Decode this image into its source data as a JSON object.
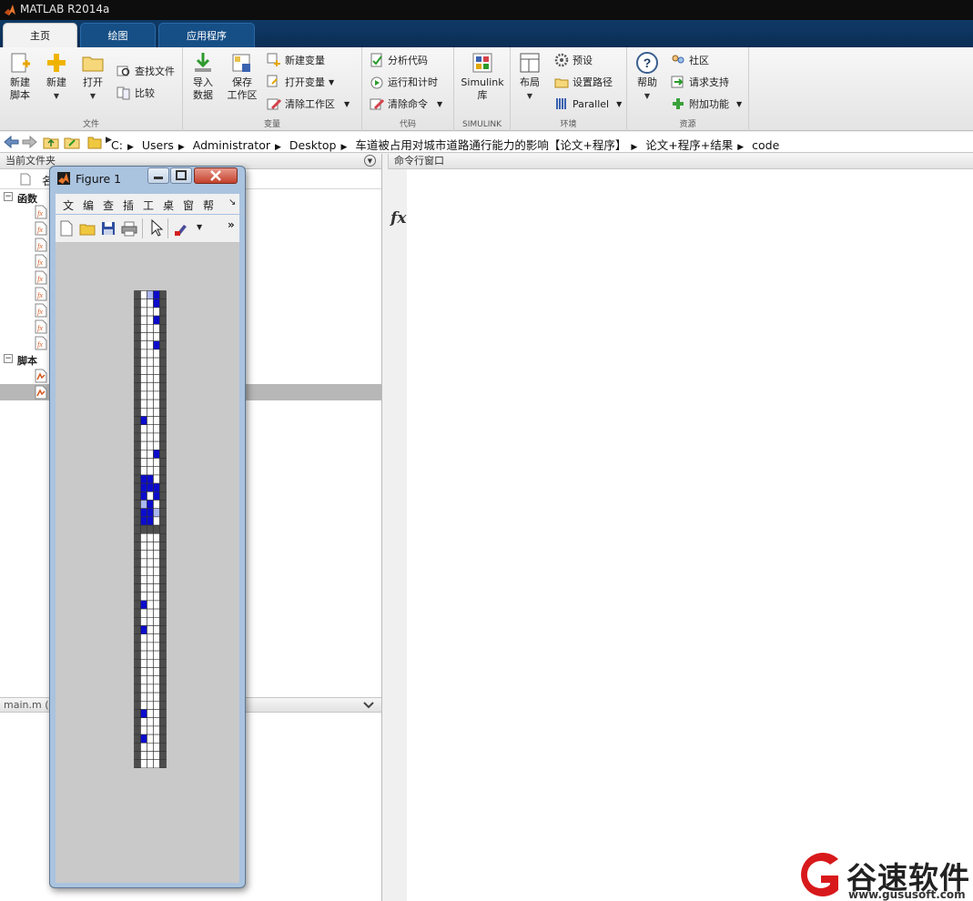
{
  "window": {
    "title": "MATLAB R2014a"
  },
  "tabs": [
    {
      "label": "主页"
    },
    {
      "label": "绘图"
    },
    {
      "label": "应用程序"
    }
  ],
  "ribbon": {
    "file": {
      "label": "文件",
      "new_script": [
        "新建",
        "脚本"
      ],
      "new": "新建",
      "open": "打开",
      "find_files": "查找文件",
      "compare": "比较"
    },
    "variable": {
      "label": "变量",
      "import": [
        "导入",
        "数据"
      ],
      "save": [
        "保存",
        "工作区"
      ],
      "new_var": "新建变量",
      "open_var": "打开变量",
      "clear_ws": "清除工作区"
    },
    "code": {
      "label": "代码",
      "analyze": "分析代码",
      "run_time": "运行和计时",
      "clear_cmd": "清除命令"
    },
    "simulink": {
      "label": "SIMULINK",
      "lib": [
        "Simulink",
        "库"
      ]
    },
    "env": {
      "label": "环境",
      "layout": "布局",
      "prefs": "预设",
      "set_path": "设置路径",
      "parallel": "Parallel"
    },
    "resources": {
      "label": "资源",
      "help": "帮助",
      "community": "社区",
      "support": "请求支持",
      "addons": "附加功能"
    }
  },
  "address": {
    "segments": [
      "C:",
      "Users",
      "Administrator",
      "Desktop",
      "车道被占用对城市道路通行能力的影响【论文+程序】",
      "论文+程序+结果",
      "code"
    ]
  },
  "left_panel": {
    "title": "当前文件夹",
    "column_name": "名",
    "section_functions": "函数",
    "section_scripts": "脚本",
    "details_file": "main.m ("
  },
  "cmd_window": {
    "title": "命令行窗口",
    "prompt": "fx"
  },
  "figure": {
    "title": "Figure 1",
    "menu": [
      "文",
      "编",
      "查",
      "插",
      "工",
      "桌",
      "窗",
      "帮"
    ],
    "grid": {
      "cols": 5,
      "rows": 57,
      "lane_columns": [
        1,
        2,
        3
      ],
      "separator_rows": [
        28
      ],
      "dark_cells": [
        [
          0,
          3
        ],
        [
          1,
          3
        ],
        [
          3,
          3
        ],
        [
          6,
          3
        ],
        [
          15,
          1
        ],
        [
          19,
          3
        ],
        [
          22,
          1
        ],
        [
          22,
          2
        ],
        [
          23,
          1
        ],
        [
          23,
          2
        ],
        [
          23,
          3
        ],
        [
          24,
          1
        ],
        [
          24,
          3
        ],
        [
          25,
          2
        ],
        [
          26,
          1
        ],
        [
          26,
          2
        ],
        [
          27,
          1
        ],
        [
          27,
          2
        ],
        [
          37,
          1
        ],
        [
          40,
          1
        ],
        [
          50,
          1
        ],
        [
          53,
          1
        ]
      ],
      "light_cells": [
        [
          0,
          2
        ],
        [
          25,
          1
        ],
        [
          26,
          3
        ]
      ],
      "colors": {
        "road": "#ffffff",
        "edge": "#4d4d4d",
        "car": "#0c0ccc",
        "light": "#aab6ee",
        "line": "#333333"
      }
    }
  },
  "watermark": {
    "brand": "谷速软件",
    "url": "www.gususoft.com"
  }
}
